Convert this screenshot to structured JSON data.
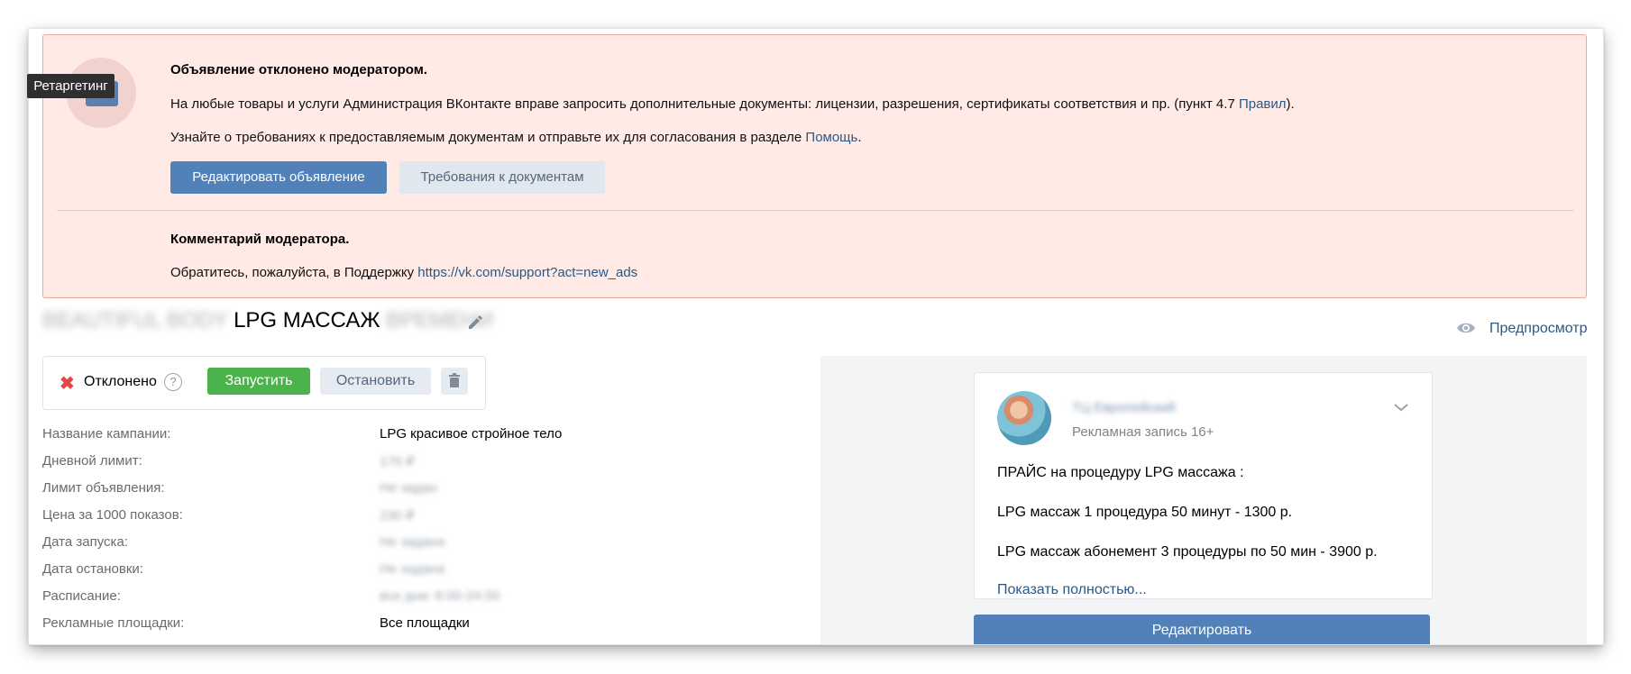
{
  "colors": {
    "accent": "#5181b8",
    "link": "#2a5885",
    "alert_bg": "#ffeae6",
    "alert_border": "#f0a89c",
    "success": "#4bb34b",
    "error": "#e64646"
  },
  "tooltip": {
    "text": "Ретаргетинг"
  },
  "alert": {
    "icon": "folder-icon",
    "title": "Объявление отклонено модератором.",
    "line1_text": "На любые товары и услуги Администрация ВКонтакте вправе запросить дополнительные документы: лицензии, разрешения, сертификаты соответствия и пр. (пункт 4.7 ",
    "line1_link": "Правил",
    "line1_tail": ").",
    "line2_text": "Узнайте о требованиях к предоставляемым документам и отправьте их для согласования в разделе ",
    "line2_link": "Помощь",
    "line2_tail": ".",
    "edit_button": "Редактировать объявление",
    "docs_button": "Требования к документам",
    "moderator_title": "Комментарий модератора.",
    "moderator_text": "Обратитесь, пожалуйста, в Поддержку ",
    "moderator_link": "https://vk.com/support?act=new_ads"
  },
  "ad": {
    "title_prefix_blurred": "BEAUTIFUL BODY",
    "title_main": "LPG МАССАЖ",
    "title_suffix_blurred": "ВРЕМЕНИ",
    "edit_icon": "pencil-icon",
    "preview_link": "Предпросмотр",
    "preview_icon": "eye-icon"
  },
  "status": {
    "state_icon": "x-icon",
    "state_text": "Отклонено",
    "help_icon": "?",
    "launch_button": "Запустить",
    "stop_button": "Остановить",
    "delete_icon": "trash-icon"
  },
  "info": [
    {
      "label": "Название кампании:",
      "value": "LPG красивое стройное тело",
      "blurred": false
    },
    {
      "label": "Дневной лимит:",
      "value": "170 ₽",
      "blurred": true
    },
    {
      "label": "Лимит объявления:",
      "value": "Не задан",
      "blurred": true
    },
    {
      "label": "Цена за 1000 показов:",
      "value": "230 ₽",
      "blurred": true
    },
    {
      "label": "Дата запуска:",
      "value": "Не задана",
      "blurred": true
    },
    {
      "label": "Дата остановки:",
      "value": "Не задана",
      "blurred": true
    },
    {
      "label": "Расписание:",
      "value": "все дни: 8:00-24:00",
      "blurred": true
    },
    {
      "label": "Рекламные площадки:",
      "value": "Все площадки",
      "blurred": false
    }
  ],
  "post": {
    "author_blurred": "ТЦ Европейский",
    "subtitle": "Рекламная запись 16+",
    "menu_icon": "chevron-down-icon",
    "line1": "ПРАЙС на процедуру LPG массажа :",
    "line2": "LPG массаж 1 процедура 50 минут - 1300 р.",
    "line3": "LPG массаж абонемент 3 процедуры по 50 мин - 3900 р.",
    "more_link": "Показать полностью...",
    "edit_button": "Редактировать"
  }
}
